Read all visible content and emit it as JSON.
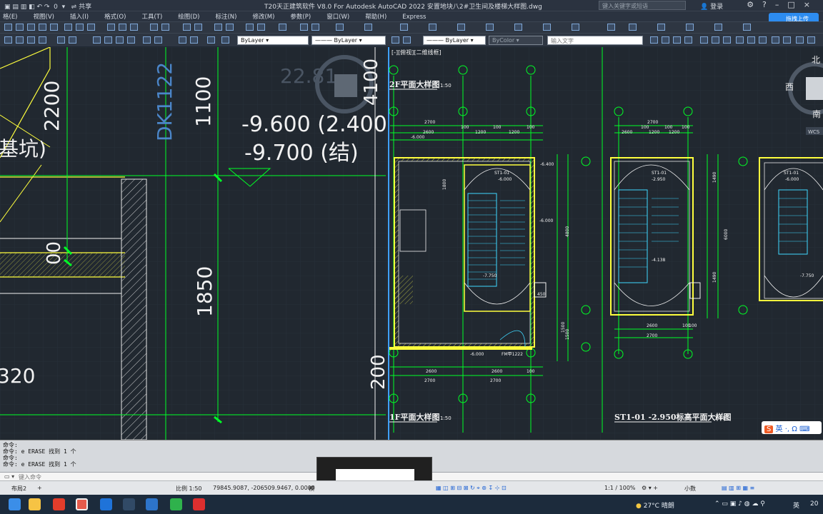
{
  "titlebar": {
    "quick_layer": "0",
    "share": "共享",
    "title": "T20天正建筑软件 V8.0 For Autodesk AutoCAD 2022    安置地块八2#卫生间及楼梯大样图.dwg",
    "search_placeholder": "键入关键字或短语",
    "login": "登录"
  },
  "menubar": [
    "格(E)",
    "视图(V)",
    "插入(I)",
    "格式(O)",
    "工具(T)",
    "绘图(D)",
    "标注(N)",
    "修改(M)",
    "参数(P)",
    "窗口(W)",
    "帮助(H)",
    "Express"
  ],
  "cloud_button": "拖拽上传",
  "properties": {
    "layer": "ByLayer",
    "linetype": "ByLayer",
    "lineweight": "ByLayer",
    "color": "ByColor",
    "text_input_placeholder": "输入文字"
  },
  "drawing": {
    "left_texts": {
      "dim_2200": "2200",
      "dim_1100": "1100",
      "dk_label": "DK1122",
      "elev1": "-9.600 (2.400",
      "elev2": "-9.700 (结)",
      "pit_label": "基坑)",
      "dim_1850": "1850",
      "dim_320": "320",
      "dim_00": "00",
      "compass_value": "22.81"
    },
    "right_texts": {
      "viewport_label": "[-][俯视][二维线框]",
      "title_2f": "2F平面大样图",
      "scale_2f": "1:50",
      "title_1f": "1F平面大样图",
      "scale_1f": "1:50",
      "title_st": "ST1-01 -2.950标高平面大样图",
      "scale_st": "1:50",
      "compass_n": "北",
      "compass_w": "西",
      "compass_s": "南",
      "wcs": "WCS",
      "st101": "ST1-01",
      "e6000": "-6.000",
      "e2950": "-2.950",
      "e7750": "-7.750",
      "e6400": "-6.400",
      "e4138": "-4.138",
      "fm": "FM甲1222",
      "dims": [
        "2700",
        "2600",
        "100",
        "1200",
        "100",
        "1200",
        "100",
        "2700",
        "2600",
        "100",
        "1200",
        "100",
        "1200",
        "100",
        "4800",
        "6000",
        "1490",
        "1500",
        "1490",
        "450",
        "2600",
        "2600",
        "100",
        "2700",
        "2700",
        "2600",
        "100",
        "100",
        "2700",
        "1800",
        "1500"
      ]
    }
  },
  "command_history": [
    "命令:",
    "命令: e ERASE 找到 1 个",
    "命令:",
    "命令: e ERASE 找到 1 个"
  ],
  "command_placeholder": "键入命令",
  "status": {
    "layout_tab": "布局2",
    "scale": "比例 1:50",
    "coords": "79845.9087, -206509.9467, 0.0000",
    "extra": "模",
    "zoom": "1:1 / 100%",
    "units": "小数"
  },
  "taskbar": {
    "weather": "27°C 晴朗",
    "ime": "英",
    "time_partial": "20"
  },
  "colors": {
    "canvas": "#212830",
    "grid": "#2d3742",
    "green": "#00ff26",
    "yellow": "#ffff3d",
    "cyan": "#3fd8ff",
    "white": "#f2f2f2",
    "blue_accent": "#2d8cf0"
  }
}
